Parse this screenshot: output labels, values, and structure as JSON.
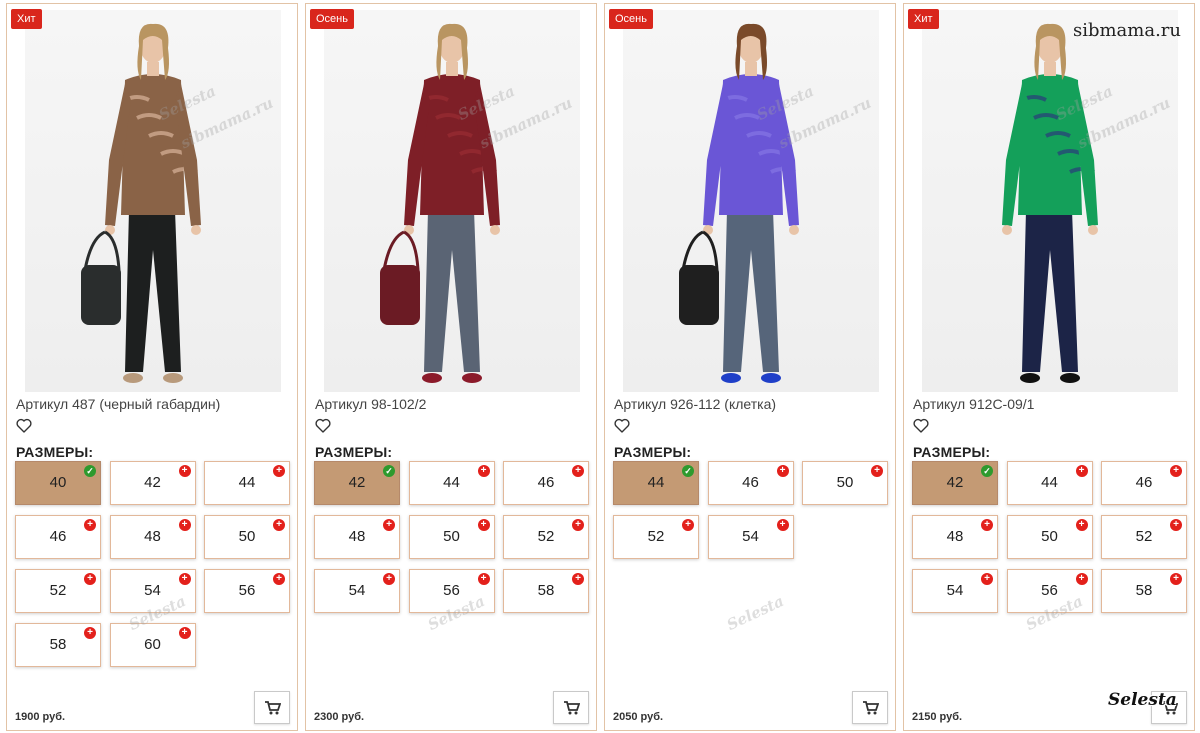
{
  "products": [
    {
      "badge": "Хит",
      "title": "Артикул 487 (черный габардин)",
      "sizes_label": "РАЗМЕРЫ:",
      "sizes": [
        "40",
        "42",
        "44",
        "46",
        "48",
        "50",
        "52",
        "54",
        "56",
        "58",
        "60"
      ],
      "selected_size": "40",
      "price": "1900 руб.",
      "outfit": {
        "top": "#8a6347",
        "top_stripe": "#d8b49a",
        "pants": "#1d1f1f",
        "shoes": "#b89a7c",
        "bag": "#2a2d2d"
      }
    },
    {
      "badge": "Осень",
      "title": "Артикул 98-102/2",
      "sizes_label": "РАЗМЕРЫ:",
      "sizes": [
        "42",
        "44",
        "46",
        "48",
        "50",
        "52",
        "54",
        "56",
        "58"
      ],
      "selected_size": "42",
      "price": "2300 руб.",
      "outfit": {
        "top": "#7e1f27",
        "top_stripe": "#9a2c33",
        "pants": "#5a6474",
        "shoes": "#8b1a2a",
        "bag": "#6b1b24"
      }
    },
    {
      "badge": "Осень",
      "title": "Артикул 926-112 (клетка)",
      "sizes_label": "РАЗМЕРЫ:",
      "sizes": [
        "44",
        "46",
        "50",
        "52",
        "54"
      ],
      "selected_size": "44",
      "price": "2050 руб.",
      "outfit": {
        "top": "#6a56d6",
        "top_stripe": "#8676e4",
        "pants": "#56657a",
        "shoes": "#1f3fc8",
        "bag": "#1f1f1f"
      }
    },
    {
      "badge": "Хит",
      "title": "Артикул 912С-09/1",
      "sizes_label": "РАЗМЕРЫ:",
      "sizes": [
        "42",
        "44",
        "46",
        "48",
        "50",
        "52",
        "54",
        "56",
        "58"
      ],
      "selected_size": "42",
      "price": "2150 руб.",
      "outfit": {
        "top": "#14a05a",
        "top_stripe": "#2a3a7a",
        "pants": "#1c2447",
        "shoes": "#111111",
        "bag": ""
      }
    }
  ],
  "watermarks": {
    "site": "sibmama.ru",
    "brand": "Selesta"
  },
  "colors": {
    "badge": "#d9261c",
    "selected_size": "#c49a74",
    "card_border": "#e2c3a6",
    "plus_mark": "#e3201b",
    "check_mark": "#2e9a2e"
  },
  "icons": {
    "favorite": "heart-outline-icon",
    "cart": "shopping-cart-icon",
    "available": "plus-circle-icon",
    "selected": "check-circle-icon"
  }
}
